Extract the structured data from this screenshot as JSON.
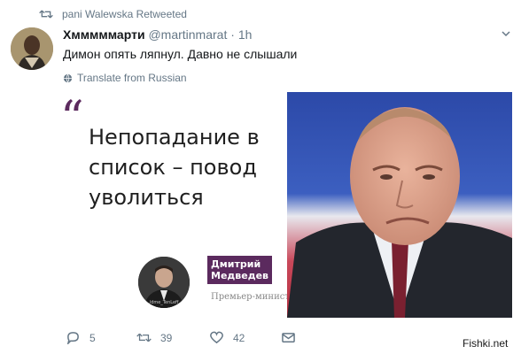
{
  "retweet": {
    "text": "pani Walewska Retweeted"
  },
  "tweet": {
    "display_name": "Хмммммарти",
    "handle": "@martinmarat",
    "separator": "·",
    "time": "1h",
    "text": "Димон опять ляпнул. Давно не слышали",
    "translate": "Translate from Russian"
  },
  "media": {
    "quote_mark": "“",
    "quote_lines": [
      "Непопадание в",
      "список – повод",
      "уволиться"
    ],
    "speaker_name_lines": [
      "Дмитрий",
      "Медведев"
    ],
    "speaker_role": "Премьер-министр",
    "speaker_photo_caption": "/dme_TenLeff"
  },
  "actions": {
    "replies": "5",
    "retweets": "39",
    "likes": "42"
  },
  "watermark": "Fishki.net",
  "colors": {
    "accent_purple": "#5b2a5e",
    "meta_gray": "#657786"
  },
  "icons": {
    "retweet": "retweet-icon",
    "reply": "reply-icon",
    "like": "heart-icon",
    "message": "envelope-icon",
    "globe": "globe-icon",
    "chevron": "chevron-down-icon"
  }
}
